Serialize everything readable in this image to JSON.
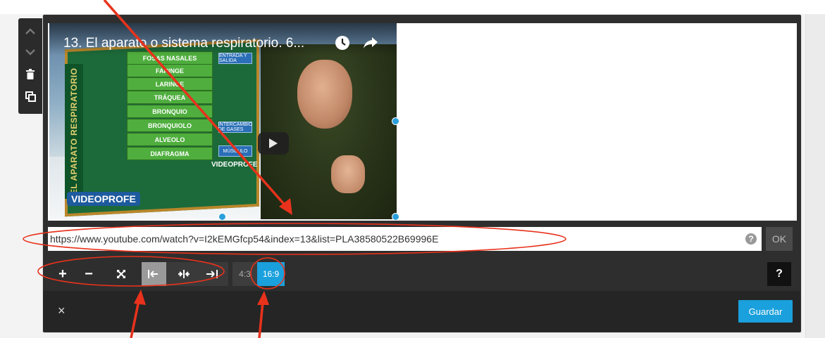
{
  "video": {
    "title": "13. El aparato o sistema respiratorio. 6...",
    "board_heading": "EL APARATO RESPIRATORIO",
    "board_items": [
      "FOSAS NASALES",
      "FARINGE",
      "LARINGE",
      "TRÁQUEA",
      "BRONQUIO",
      "BRONQUIOLO",
      "ALVEOLO",
      "DIAFRAGMA"
    ],
    "board_tags": [
      "ENTRADA Y SALIDA",
      "INTERCAMBIO DE GASES",
      "MÚSCULO"
    ],
    "logo": "VIDEOPROFE",
    "logo_watermark": "VIDEOPROFE"
  },
  "url_field": {
    "value": "https://www.youtube.com/watch?v=I2kEMGfcp54&index=13&list=PLA38580522B69996E"
  },
  "ok_label": "OK",
  "help_symbol": "?",
  "toolbar": {
    "zoom_in": "+",
    "zoom_out": "−",
    "ratio_43": "4:3",
    "ratio_169": "16:9",
    "help": "?"
  },
  "footer": {
    "close": "×",
    "save": "Guardar"
  },
  "colors": {
    "accent": "#1aa0dc",
    "annotation": "#e8321c",
    "panel": "#2e2e2e"
  }
}
